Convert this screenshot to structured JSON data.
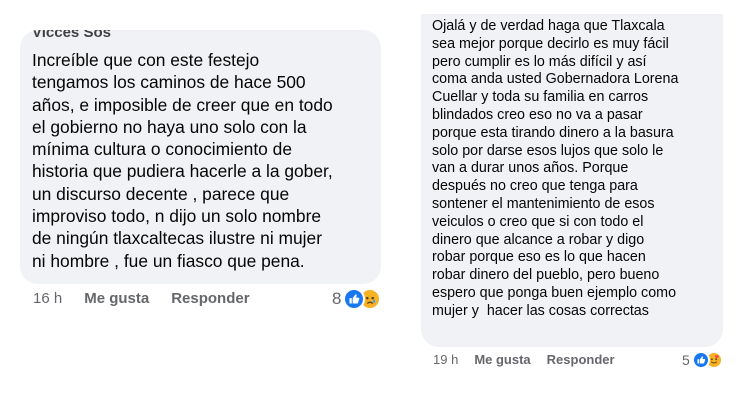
{
  "comment_left": {
    "author": "Vicces Sos",
    "text": "Increíble que con este festejo\ntengamos los caminos de hace 500\naños, e imposible de creer que en todo\nel gobierno no haya uno solo con la\nmínima cultura o conocimiento de\nhistoria que pudiera hacerle a la gober,\nun discurso decente , parece que\nimproviso todo, n dijo un solo nombre\nde ningún tlaxcaltecas ilustre ni mujer\nni hombre , fue un fiasco que pena.",
    "time": "16 h",
    "like_label": "Me gusta",
    "reply_label": "Responder",
    "reaction_count": "8",
    "reaction_icons": [
      "like-icon",
      "sad-icon"
    ]
  },
  "comment_right": {
    "text": "Ojalá y de verdad haga que Tlaxcala\nsea mejor porque decirlo es muy fácil\npero cumplir es lo más difícil y así\ncoma anda usted Gobernadora Lorena\nCuellar y toda su familia en carros\nblindados creo eso no va a pasar\nporque esta tirando dinero a la basura\nsolo por darse esos lujos que solo le\nvan a durar unos años. Porque\ndespués no creo que tenga para\nsontener el mantenimiento de esos\nveiculos o creo que si con todo el\ndinero que alcance a robar y digo\nrobar porque eso es lo que hacen\nrobar dinero del pueblo, pero bueno\nespero que ponga buen ejemplo como\nmujer y  hacer las cosas correctas",
    "time": "19 h",
    "like_label": "Me gusta",
    "reply_label": "Responder",
    "reaction_count": "5",
    "reaction_icons": [
      "like-icon",
      "love-icon"
    ]
  },
  "colors": {
    "bubble": "#f0f2f5",
    "meta_text": "#65676b",
    "like_blue": "#1877f2",
    "emoji_yellow": "#f7b125"
  }
}
